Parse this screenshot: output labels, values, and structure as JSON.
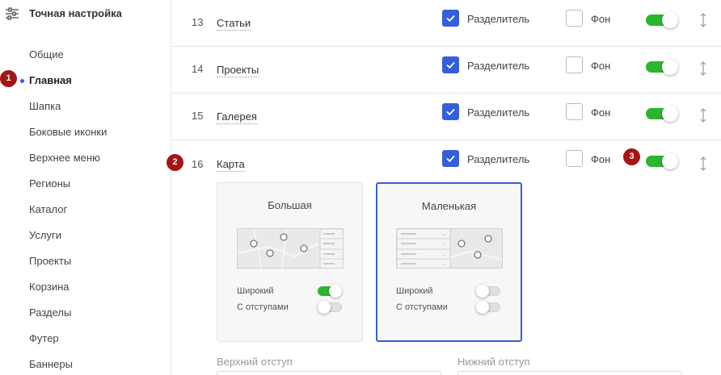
{
  "sidebar": {
    "title": "Точная настройка",
    "items": [
      {
        "label": "Общие",
        "active": false
      },
      {
        "label": "Главная",
        "active": true
      },
      {
        "label": "Шапка",
        "active": false
      },
      {
        "label": "Боковые иконки",
        "active": false
      },
      {
        "label": "Верхнее меню",
        "active": false
      },
      {
        "label": "Регионы",
        "active": false
      },
      {
        "label": "Каталог",
        "active": false
      },
      {
        "label": "Услуги",
        "active": false
      },
      {
        "label": "Проекты",
        "active": false
      },
      {
        "label": "Корзина",
        "active": false
      },
      {
        "label": "Разделы",
        "active": false
      },
      {
        "label": "Футер",
        "active": false
      },
      {
        "label": "Баннеры",
        "active": false
      }
    ]
  },
  "badges": [
    "1",
    "2",
    "3"
  ],
  "rows": [
    {
      "num": "13",
      "name": "Статьи",
      "divider_label": "Разделитель",
      "divider_checked": true,
      "bg_label": "Фон",
      "bg_checked": false,
      "enabled": true
    },
    {
      "num": "14",
      "name": "Проекты",
      "divider_label": "Разделитель",
      "divider_checked": true,
      "bg_label": "Фон",
      "bg_checked": false,
      "enabled": true
    },
    {
      "num": "15",
      "name": "Галерея",
      "divider_label": "Разделитель",
      "divider_checked": true,
      "bg_label": "Фон",
      "bg_checked": false,
      "enabled": true
    },
    {
      "num": "16",
      "name": "Карта",
      "divider_label": "Разделитель",
      "divider_checked": true,
      "bg_label": "Фон",
      "bg_checked": false,
      "enabled": true
    }
  ],
  "map_options": [
    {
      "title": "Большая",
      "selected": false,
      "wide_label": "Широкий",
      "wide_on": true,
      "padding_label": "С отступами",
      "padding_on": false
    },
    {
      "title": "Маленькая",
      "selected": true,
      "wide_label": "Широкий",
      "wide_on": false,
      "padding_label": "С отступами",
      "padding_on": false
    }
  ],
  "fields": {
    "top_padding_label": "Верхний отступ",
    "bottom_padding_label": "Нижний отступ"
  },
  "colors": {
    "accent": "#365edc",
    "toggle_on": "#2db52d",
    "badge": "#a51515"
  },
  "icons": {
    "settings": "settings-sliders-icon",
    "drag": "drag-vertical-icon",
    "map_pin": "map-pin-icon"
  }
}
